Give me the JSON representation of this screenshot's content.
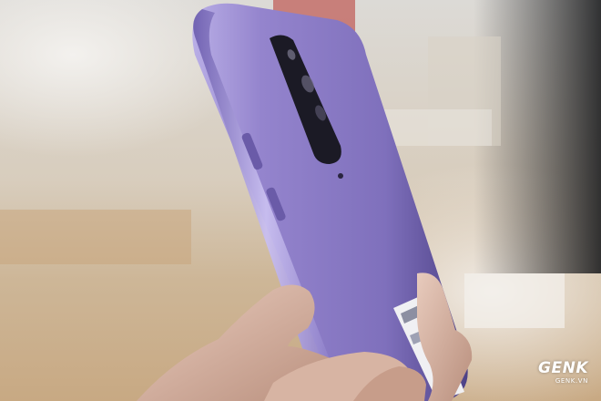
{
  "photo": {
    "subject": "purple-smartphone-back-in-hand",
    "colors": {
      "phone_body": "#8f7fc6",
      "phone_highlight": "#b9aee6",
      "phone_shadow": "#4d4186",
      "camera_module": "#1b1a25",
      "skin": "#d9b8a8",
      "background_light": "#eeece8",
      "background_wood": "#c9a67c"
    }
  },
  "watermark": {
    "brand": "GENK",
    "domain": "GENK.VN"
  }
}
